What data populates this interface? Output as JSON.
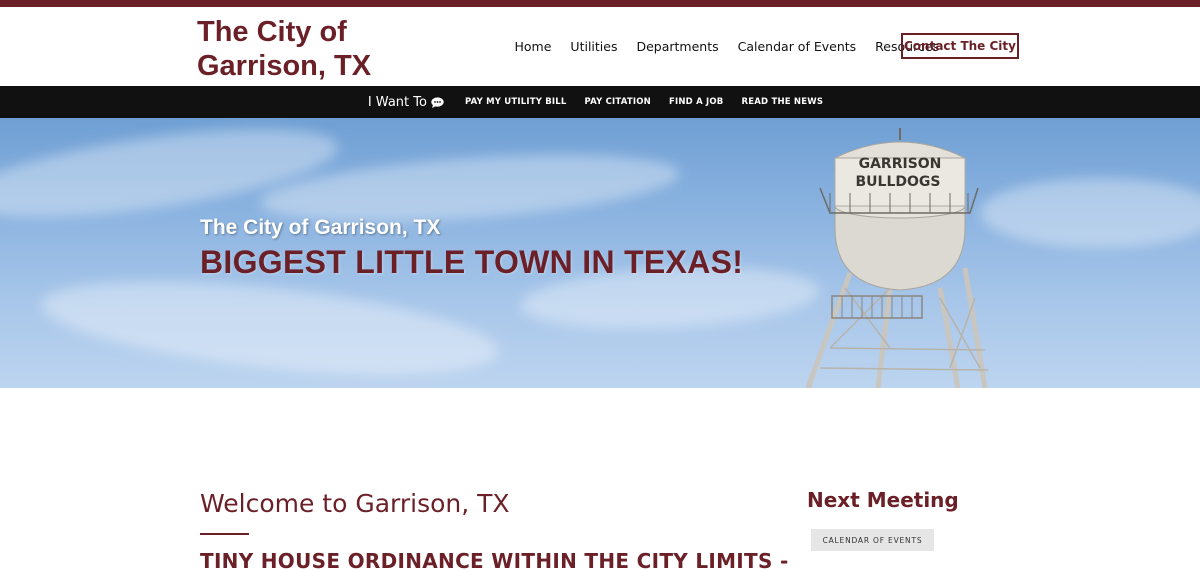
{
  "colors": {
    "brand": "#6b1f27",
    "subnav_bg": "#111111",
    "sky": "#8bb3e0"
  },
  "header": {
    "logo_line1": "The City of",
    "logo_line2": "Garrison, TX",
    "nav": [
      "Home",
      "Utilities",
      "Departments",
      "Calendar of Events",
      "Resources"
    ],
    "contact_label": "Contact The City"
  },
  "subnav": {
    "iwant_label": "I Want To",
    "iwant_icon": "chat-bubble-icon",
    "links": [
      "PAY MY UTILITY BILL",
      "PAY CITATION",
      "FIND A JOB",
      "READ THE NEWS"
    ]
  },
  "hero": {
    "subtitle": "The City of Garrison, TX",
    "title": "BIGGEST LITTLE TOWN IN TEXAS!",
    "tower_text_line1": "GARRISON",
    "tower_text_line2": "BULLDOGS"
  },
  "main": {
    "welcome_title": "Welcome to Garrison, TX",
    "ordinance_heading": "TINY HOUSE ORDINANCE WITHIN THE CITY LIMITS -"
  },
  "sidebar": {
    "next_meeting_title": "Next Meeting",
    "calendar_button": "CALENDAR OF EVENTS"
  }
}
